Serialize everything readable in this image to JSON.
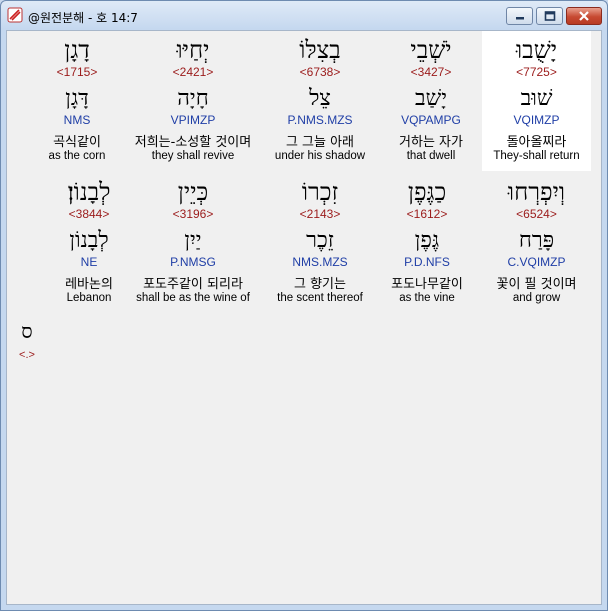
{
  "window": {
    "title": "@원전분해 - 호 14:7",
    "controls": {
      "minimize": "minimize",
      "maximize": "maximize",
      "close": "close"
    }
  },
  "rows": [
    {
      "words": [
        {
          "hebrew": "דָגָן",
          "strongs": "<1715>",
          "lemma": "דָּגָן",
          "morph": "NMS",
          "korean": "곡식같이",
          "english": "as the corn"
        },
        {
          "hebrew": "יְחַיּוּ",
          "strongs": "<2421>",
          "lemma": "חָיָה",
          "morph": "VPIMZP",
          "korean": "저희는-소성할 것이며",
          "english": "they shall revive"
        },
        {
          "hebrew": "בְצִלּוֹ",
          "strongs": "<6738>",
          "lemma": "צֵל",
          "morph": "P.NMS.MZS",
          "korean": "그 그늘 아래",
          "english": "under his shadow"
        },
        {
          "hebrew": "יֹשְׁבֵי",
          "strongs": "<3427>",
          "lemma": "יָשַׁב",
          "morph": "VQPAMPG",
          "korean": "거하는 자가",
          "english": "that dwell"
        },
        {
          "hebrew": "יָשֻׁבוּ",
          "strongs": "<7725>",
          "lemma": "שׁוּב",
          "morph": "VQIMZP",
          "korean": "돌아올찌라",
          "english": "They-shall return"
        }
      ]
    },
    {
      "words": [
        {
          "hebrew": "לְבָנוֹן׃",
          "strongs": "<3844>",
          "lemma": "לְבָנוֹן",
          "morph": "NE",
          "korean": "레바논의",
          "english": "Lebanon"
        },
        {
          "hebrew": "כְּיֵין",
          "strongs": "<3196>",
          "lemma": "יַיִן",
          "morph": "P.NMSG",
          "korean": "포도주같이 되리라",
          "english": "shall be as the wine of"
        },
        {
          "hebrew": "זִכְרוֹ",
          "strongs": "<2143>",
          "lemma": "זֵכֶר",
          "morph": "NMS.MZS",
          "korean": "그 향기는",
          "english": "the scent thereof"
        },
        {
          "hebrew": "כַגֶּפֶן",
          "strongs": "<1612>",
          "lemma": "גֶּפֶן",
          "morph": "P.D.NFS",
          "korean": "포도나무같이",
          "english": "as the vine"
        },
        {
          "hebrew": "וְיִפְרְחוּ",
          "strongs": "<6524>",
          "lemma": "פָּרַח",
          "morph": "C.VQIMZP",
          "korean": "꽃이 필 것이며",
          "english": "and grow"
        }
      ]
    }
  ],
  "verse_end": {
    "symbol": "ס",
    "marker": "<.>"
  },
  "colors": {
    "strongs": "#9b1b1b",
    "morph": "#1f3ea6",
    "highlight": "#ffffff",
    "background": "#f0f0f0"
  }
}
